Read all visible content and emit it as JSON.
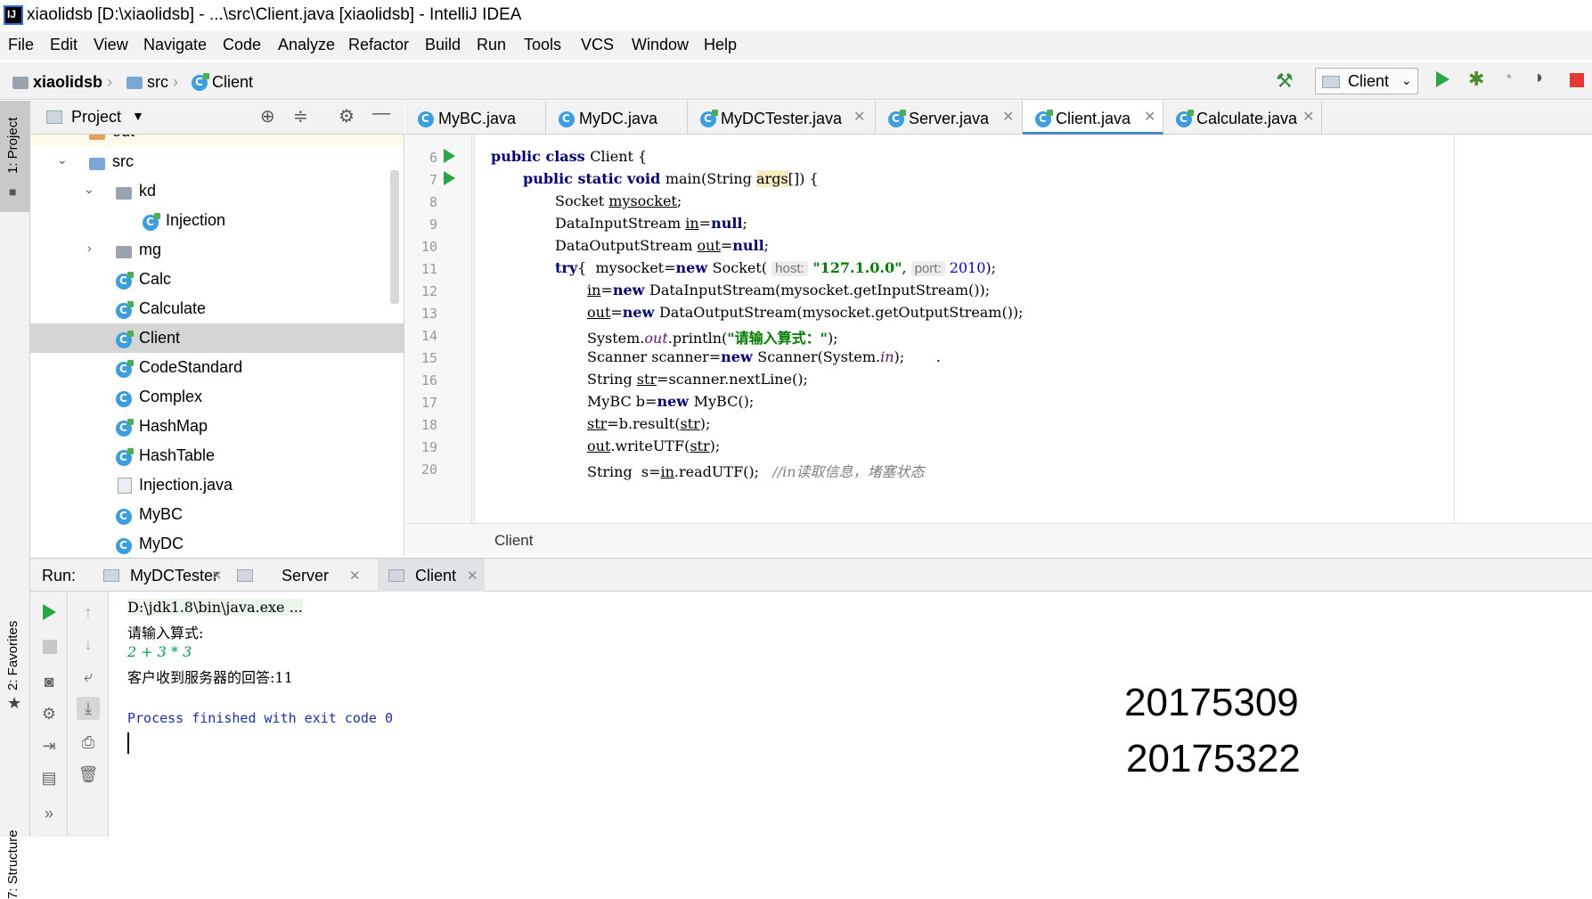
{
  "window": {
    "title": "xiaolidsb [D:\\xiaolidsb] - ...\\src\\Client.java [xiaolidsb] - IntelliJ IDEA",
    "app_icon_text": "IJ"
  },
  "menu": [
    "File",
    "Edit",
    "View",
    "Navigate",
    "Code",
    "Analyze",
    "Refactor",
    "Build",
    "Run",
    "Tools",
    "VCS",
    "Window",
    "Help"
  ],
  "navbar": {
    "crumbs": [
      "xiaolidsb",
      "src",
      "Client"
    ],
    "run_config": "Client"
  },
  "left_strip": {
    "project_tab": "1: Project",
    "favorites_tab": "2: Favorites",
    "structure_tab": "7: Structure"
  },
  "project_panel": {
    "title": "Project",
    "tree": [
      {
        "label": "out",
        "kind": "folder-orange"
      },
      {
        "label": "src",
        "kind": "folder"
      },
      {
        "label": "kd",
        "kind": "package"
      },
      {
        "label": "Injection",
        "kind": "class"
      },
      {
        "label": "mg",
        "kind": "package"
      },
      {
        "label": "Calc",
        "kind": "class"
      },
      {
        "label": "Calculate",
        "kind": "class"
      },
      {
        "label": "Client",
        "kind": "class"
      },
      {
        "label": "CodeStandard",
        "kind": "class"
      },
      {
        "label": "Complex",
        "kind": "class"
      },
      {
        "label": "HashMap",
        "kind": "class"
      },
      {
        "label": "HashTable",
        "kind": "class"
      },
      {
        "label": "Injection.java",
        "kind": "file"
      },
      {
        "label": "MyBC",
        "kind": "class"
      },
      {
        "label": "MyDC",
        "kind": "class"
      }
    ],
    "selected": "Client"
  },
  "editor_tabs": [
    "MyBC.java",
    "MyDC.java",
    "MyDCTester.java",
    "Server.java",
    "Client.java",
    "Calculate.java"
  ],
  "active_tab": "Client.java",
  "editor": {
    "line_numbers": [
      "6",
      "7",
      "8",
      "9",
      "10",
      "11",
      "12",
      "13",
      "14",
      "15",
      "16",
      "17",
      "18",
      "19",
      "20"
    ],
    "lines": {
      "l6a": "public class ",
      "l6b": "Client {",
      "l7a": "public static void ",
      "l7b": "main(String ",
      "l7c": "args",
      "l7d": "[]) {",
      "l8a": "Socket ",
      "l8b": "mysocket",
      "l8c": ";",
      "l9a": "DataInputStream ",
      "l9b": "in",
      "l9c": "=",
      "l9d": "null",
      "l9e": ";",
      "l10a": "DataOutputStream ",
      "l10b": "out",
      "l10c": "=",
      "l10d": "null",
      "l10e": ";",
      "l11a": "try",
      "l11b": "{  mysocket=",
      "l11c": "new ",
      "l11d": "Socket( ",
      "l11h1": "host:",
      "l11s": " \"127.1.0.0\"",
      "l11e": ", ",
      "l11h2": "port:",
      "l11n": " 2010",
      "l11f": ");",
      "l12a": "in",
      "l12b": "=",
      "l12c": "new ",
      "l12d": "DataInputStream(mysocket.getInputStream());",
      "l13a": "out",
      "l13b": "=",
      "l13c": "new ",
      "l13d": "DataOutputStream(mysocket.getOutputStream());",
      "l14a": "System.",
      "l14b": "out",
      "l14c": ".println(",
      "l14d": "\"请输入算式：\"",
      "l14e": ");",
      "l15a": "Scanner scanner=",
      "l15b": "new ",
      "l15c": "Scanner(System.",
      "l15d": "in",
      "l15e": ");       .",
      "l16a": "String ",
      "l16b": "str",
      "l16c": "=scanner.nextLine();",
      "l17a": "MyBC b=",
      "l17b": "new ",
      "l17c": "MyBC();",
      "l18a": "str",
      "l18b": "=b.result(",
      "l18c": "str",
      "l18d": ");",
      "l19a": "out",
      "l19b": ".writeUTF(",
      "l19c": "str",
      "l19d": ");",
      "l20a": "String  s=",
      "l20b": "in",
      "l20c": ".readUTF();   ",
      "l20d": "//in读取信息，堵塞状态"
    },
    "breadcrumb": "Client"
  },
  "run_panel": {
    "label": "Run:",
    "tabs": [
      "MyDCTester",
      "Server",
      "Client"
    ],
    "active_tab": "Client",
    "console": [
      "D:\\jdk1.8\\bin\\java.exe ...",
      "请输入算式:",
      "2 + 3 * 3",
      "客户收到服务器的回答:11",
      "",
      "Process finished with exit code 0"
    ]
  },
  "overlay_ids": [
    "20175309",
    "20175322"
  ],
  "colors": {
    "keyword": "#000080",
    "string": "#008000",
    "run_green": "#28a745",
    "stop_red": "#e53935",
    "accent": "#4a88c7"
  }
}
